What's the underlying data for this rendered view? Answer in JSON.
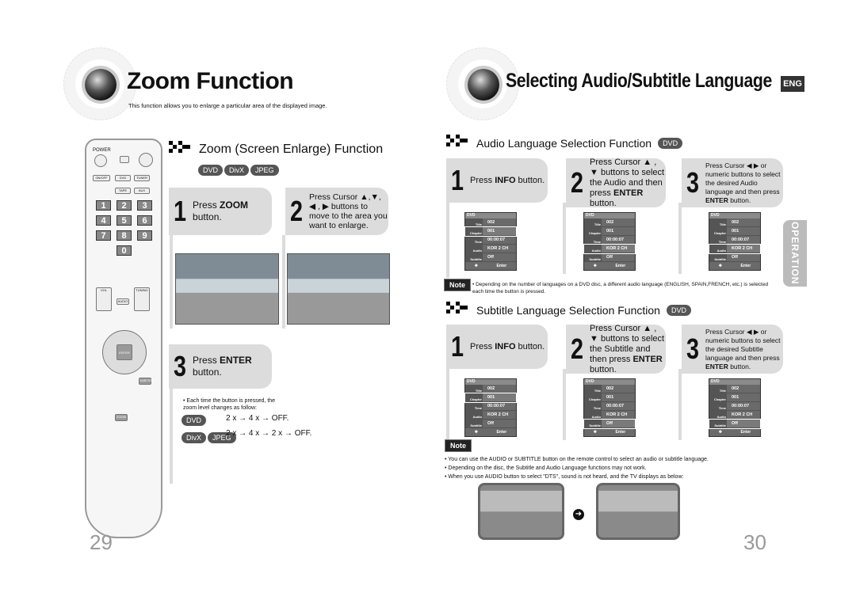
{
  "left": {
    "title": "Zoom Function",
    "subtitle": "This function allows you to enlarge a particular area of the displayed image.",
    "section_title": "Zoom (Screen Enlarge) Function",
    "badges": [
      "DVD",
      "DivX",
      "JPEG"
    ],
    "steps": [
      {
        "num": "1",
        "pre": "Press ",
        "bold": "ZOOM",
        "post": " button."
      },
      {
        "num": "2",
        "text": "Press Cursor ▲,▼, ◀ , ▶ buttons to move to the area you want to enlarge."
      },
      {
        "num": "3",
        "pre": "Press ",
        "bold": "ENTER",
        "post": " button."
      }
    ],
    "bullet": "• Each time the button is pressed, the zoom level changes as follow:",
    "seq_dvd": "2 x → 4 x → OFF.",
    "seq_divx": "2 x → 4 x → 2 x → OFF.",
    "page_number": "29",
    "remote": {
      "power": "POWER",
      "disc_skip": "DISC SKIP",
      "timer": "TIMER",
      "on_off": "ON/OFF",
      "dvd": "DVD",
      "tuner": "TUNER",
      "timer_clock": "TIMER/CLOCK",
      "tape": "TAPE",
      "aux": "AUX",
      "numbers": [
        "1",
        "2",
        "3",
        "4",
        "5",
        "6",
        "7",
        "8",
        "9",
        "0"
      ],
      "vol": "VOL",
      "tuning": "TUNING",
      "audio": "AUDIO",
      "enter": "ENTER",
      "subtitle": "SUBTITLE",
      "zoom": "ZOOM"
    }
  },
  "right": {
    "title": "Selecting Audio/Subtitle Language",
    "lang_badge": "ENG",
    "side_tab": "OPERATION",
    "page_number": "30",
    "audio": {
      "section_title": "Audio Language Selection Function",
      "badge": "DVD",
      "steps": [
        {
          "num": "1",
          "pre": "Press ",
          "bold": "INFO",
          "post": " button."
        },
        {
          "num": "2",
          "pre": "Press Cursor ▲ , ▼ buttons to select the Audio and then press ",
          "bold": "ENTER",
          "post": " button."
        },
        {
          "num": "3",
          "pre": "Press Cursor ◀ ▶ or numeric buttons to select the desired Audio language and then press ",
          "bold": "ENTER",
          "post": " button."
        }
      ],
      "highlight_rows": [
        1,
        3,
        3
      ]
    },
    "note1": {
      "label": "Note",
      "text": "• Depending on the number of languages on a DVD disc, a different audio language (ENGLISH, SPAIN,FRENCH, etc.) is selected each time the button is pressed."
    },
    "subtitle": {
      "section_title": "Subtitle Language Selection Function",
      "badge": "DVD",
      "steps": [
        {
          "num": "1",
          "pre": "Press ",
          "bold": "INFO",
          "post": " button."
        },
        {
          "num": "2",
          "pre": "Press Cursor ▲ , ▼ buttons to select the Subtitle and then press ",
          "bold": "ENTER",
          "post": " button."
        },
        {
          "num": "3",
          "pre": "Press Cursor ◀ ▶ or numeric buttons to select the desired Subtitle language and then press ",
          "bold": "ENTER",
          "post": " button."
        }
      ],
      "highlight_rows": [
        1,
        4,
        4
      ]
    },
    "menu": {
      "header": "DVD",
      "rows": [
        {
          "label": "Title",
          "value": "002"
        },
        {
          "label": "Chapter",
          "value": "001"
        },
        {
          "label": "Time",
          "value": "00:00:07"
        },
        {
          "label": "Audio",
          "value": "KOR 2 CH"
        },
        {
          "label": "Subtitle",
          "value": "Off"
        }
      ],
      "footer": "Enter"
    },
    "note2": {
      "label": "Note",
      "bullets": [
        "• You can use the AUDIO or SUBTITLE button on the remote control to select an audio or subtitle language.",
        "• Depending on the disc, the Subtitle and Audio Language functions may not work.",
        "• When you use AUDIO button to select \"DTS\", sound is not heard, and the TV displays as below:"
      ]
    }
  }
}
